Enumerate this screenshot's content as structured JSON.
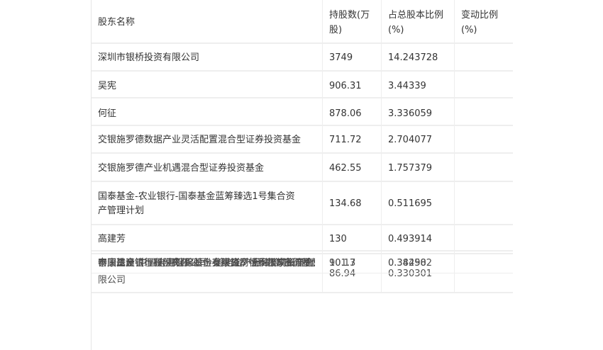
{
  "table": {
    "headers": {
      "name": "股东名称",
      "shares_l1": "持股数(万",
      "shares_l2": "股)",
      "ratio_l1": "占总股本比例",
      "ratio_l2": "(%)",
      "change_l1": "变动比例",
      "change_l2": "(%)"
    },
    "rows": [
      {
        "name": "深圳市银桥投资有限公司",
        "shares": "3749",
        "ratio": "14.243728",
        "change": ""
      },
      {
        "name": "吴宪",
        "shares": "906.31",
        "ratio": "3.44339",
        "change": ""
      },
      {
        "name": "何征",
        "shares": "878.06",
        "ratio": "3.336059",
        "change": ""
      },
      {
        "name": "交银施罗德数据产业灵活配置混合型证券投资基金",
        "shares": "711.72",
        "ratio": "2.704077",
        "change": ""
      },
      {
        "name": "交银施罗德产业机遇混合型证券投资基金",
        "shares": "462.55",
        "ratio": "1.757379",
        "change": ""
      },
      {
        "name_l1": "国泰基金-农业银行-国泰基金蓝筹臻选1号集合资",
        "name_l2": "产管理计划",
        "shares": "134.68",
        "ratio": "0.511695",
        "change": ""
      },
      {
        "name": "高建芳",
        "shares": "130",
        "ratio": "0.493914",
        "change": ""
      }
    ],
    "overlap": {
      "name_l1": "中国建设银行股份有限公司-交银施罗德积极成长混合型证券投资基金",
      "name_l1b": "富国基金-中国人寿保险股份有限公司-分红险-富国基金国寿股份成长股票型组合",
      "name_l1c": "泰康资产管理有限责任公司-泰康资产悦泰增享资产管理产品",
      "name_l1d": "中国工商银行-全国社保基金-养老金产品-招商银行股份有",
      "name_l2": "限公司",
      "shares_a": "101.3",
      "shares_b": "90.17",
      "shares_c": "86.94",
      "ratio_a": "0.384902",
      "ratio_b": "0.34258",
      "ratio_c": "0.330301"
    }
  }
}
